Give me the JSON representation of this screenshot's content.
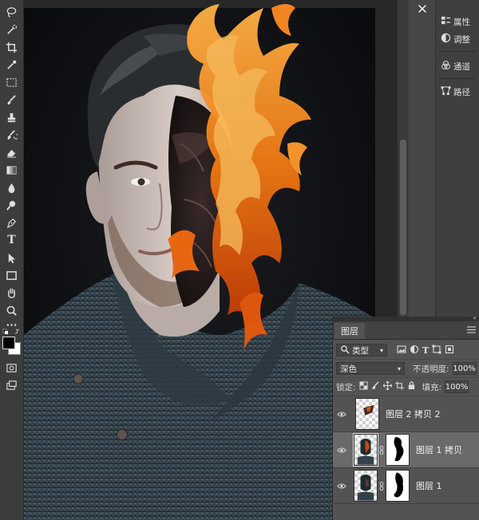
{
  "tools": [
    "lasso-icon",
    "quick-select-icon",
    "crop-icon",
    "eyedropper-icon",
    "marquee-icon",
    "brush-icon",
    "stamp-icon",
    "history-brush-icon",
    "eraser-icon",
    "gradient-icon",
    "blur-icon",
    "dodge-icon",
    "pen-icon",
    "type-icon",
    "path-select-icon",
    "rectangle-icon",
    "hand-icon",
    "zoom-icon",
    "more-tools-icon"
  ],
  "type_tool_glyph": "T",
  "side_panel": {
    "items": [
      {
        "label": "属性",
        "icon": "properties-icon"
      },
      {
        "label": "调整",
        "icon": "adjustments-icon"
      },
      {
        "label": "通道",
        "icon": "channels-icon"
      },
      {
        "label": "路径",
        "icon": "paths-icon"
      }
    ]
  },
  "layers_panel": {
    "tab": "图层",
    "filter": {
      "label": "类型"
    },
    "blend_mode": "深色",
    "opacity_label": "不透明度:",
    "opacity_value": "100%",
    "lock_label": "锁定:",
    "fill_label": "填充:",
    "fill_value": "100%",
    "layers": [
      {
        "name": "图层 2 拷贝 2",
        "visible": true,
        "selected": false,
        "has_mask": false
      },
      {
        "name": "图层 1 拷贝",
        "visible": true,
        "selected": true,
        "has_mask": true
      },
      {
        "name": "图层 1",
        "visible": true,
        "selected": false,
        "has_mask": true
      }
    ]
  },
  "colors": {
    "foreground": "#000000",
    "background": "#ffffff",
    "selected_layer_bg": "#6a6a6a"
  }
}
